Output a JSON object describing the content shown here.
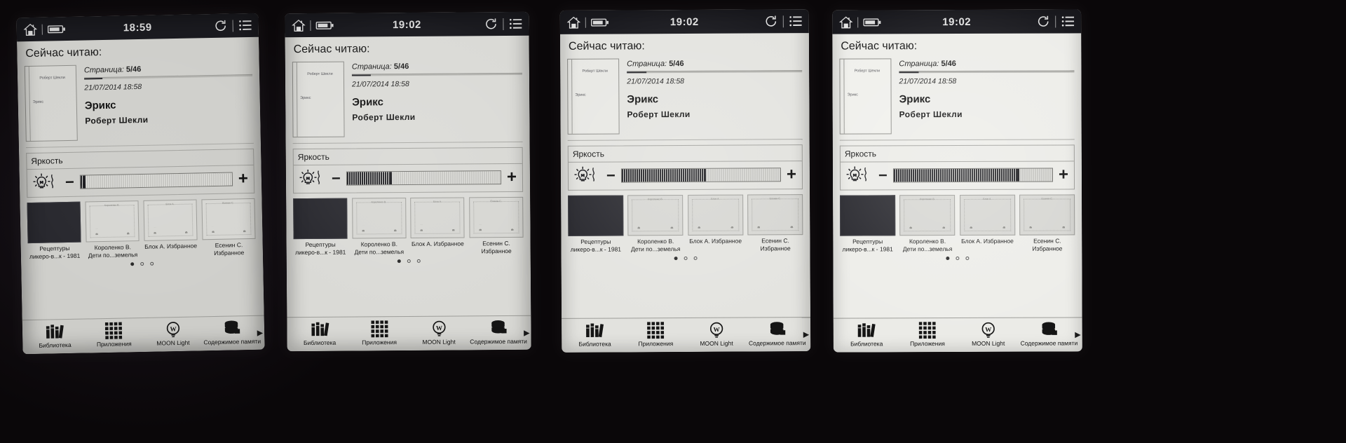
{
  "photo": {
    "description": "Photograph of an e-ink reader screen shown four times at increasing frontlight brightness",
    "panel_count": 4,
    "background_color": "#0a0709"
  },
  "status_bar": {
    "home_icon": "home-icon",
    "battery_icon": "battery-icon",
    "refresh_icon": "refresh-icon",
    "menu_icon": "menu-list-icon",
    "separator": "|"
  },
  "screen": {
    "section_title": "Сейчас читаю:",
    "book": {
      "cover_author": "Роберт Шекли",
      "cover_title": "Эрикс",
      "page_label": "Страница:",
      "page_value": "5/46",
      "progress_percent": 11,
      "date": "21/07/2014 18:58",
      "title": "Эрикс",
      "author": "Роберт Шекли"
    },
    "brightness": {
      "label": "Яркость",
      "bulb_icon": "lightbulb-icon",
      "minus_label": "−",
      "plus_label": "+"
    },
    "shelf": {
      "books": [
        {
          "line1": "Рецептуры",
          "line2": "ликеро-в...к - 1981",
          "cover_style": "dark",
          "thumb_caption": ""
        },
        {
          "line1": "Короленко В.",
          "line2": "Дети по...земелья",
          "cover_style": "ornament",
          "thumb_caption": "Короленко В."
        },
        {
          "line1": "Блок А. Избранное",
          "line2": "",
          "cover_style": "ornament",
          "thumb_caption": "Блок А."
        },
        {
          "line1": "Есенин С.",
          "line2": "Избранное",
          "cover_style": "ornament",
          "thumb_caption": "Есенин С."
        }
      ],
      "page_dots": {
        "count": 3,
        "active_index": 0
      }
    },
    "bottom_nav": {
      "items": [
        {
          "label": "Библиотека",
          "icon": "books-library-icon"
        },
        {
          "label": "Приложения",
          "icon": "apps-grid-icon"
        },
        {
          "label": "MOON Light",
          "icon": "moonlight-w-icon"
        },
        {
          "label": "Содержимое памяти",
          "icon": "storage-stack-icon"
        }
      ],
      "more_arrow": "▶"
    }
  },
  "panels": [
    {
      "id": "panel-1",
      "time": "18:59",
      "brightness_fill_percent": 2,
      "frontlight": "off"
    },
    {
      "id": "panel-2",
      "time": "19:02",
      "brightness_fill_percent": 28,
      "frontlight": "low"
    },
    {
      "id": "panel-3",
      "time": "19:02",
      "brightness_fill_percent": 52,
      "frontlight": "medium"
    },
    {
      "id": "panel-4",
      "time": "19:02",
      "brightness_fill_percent": 78,
      "frontlight": "high"
    }
  ]
}
